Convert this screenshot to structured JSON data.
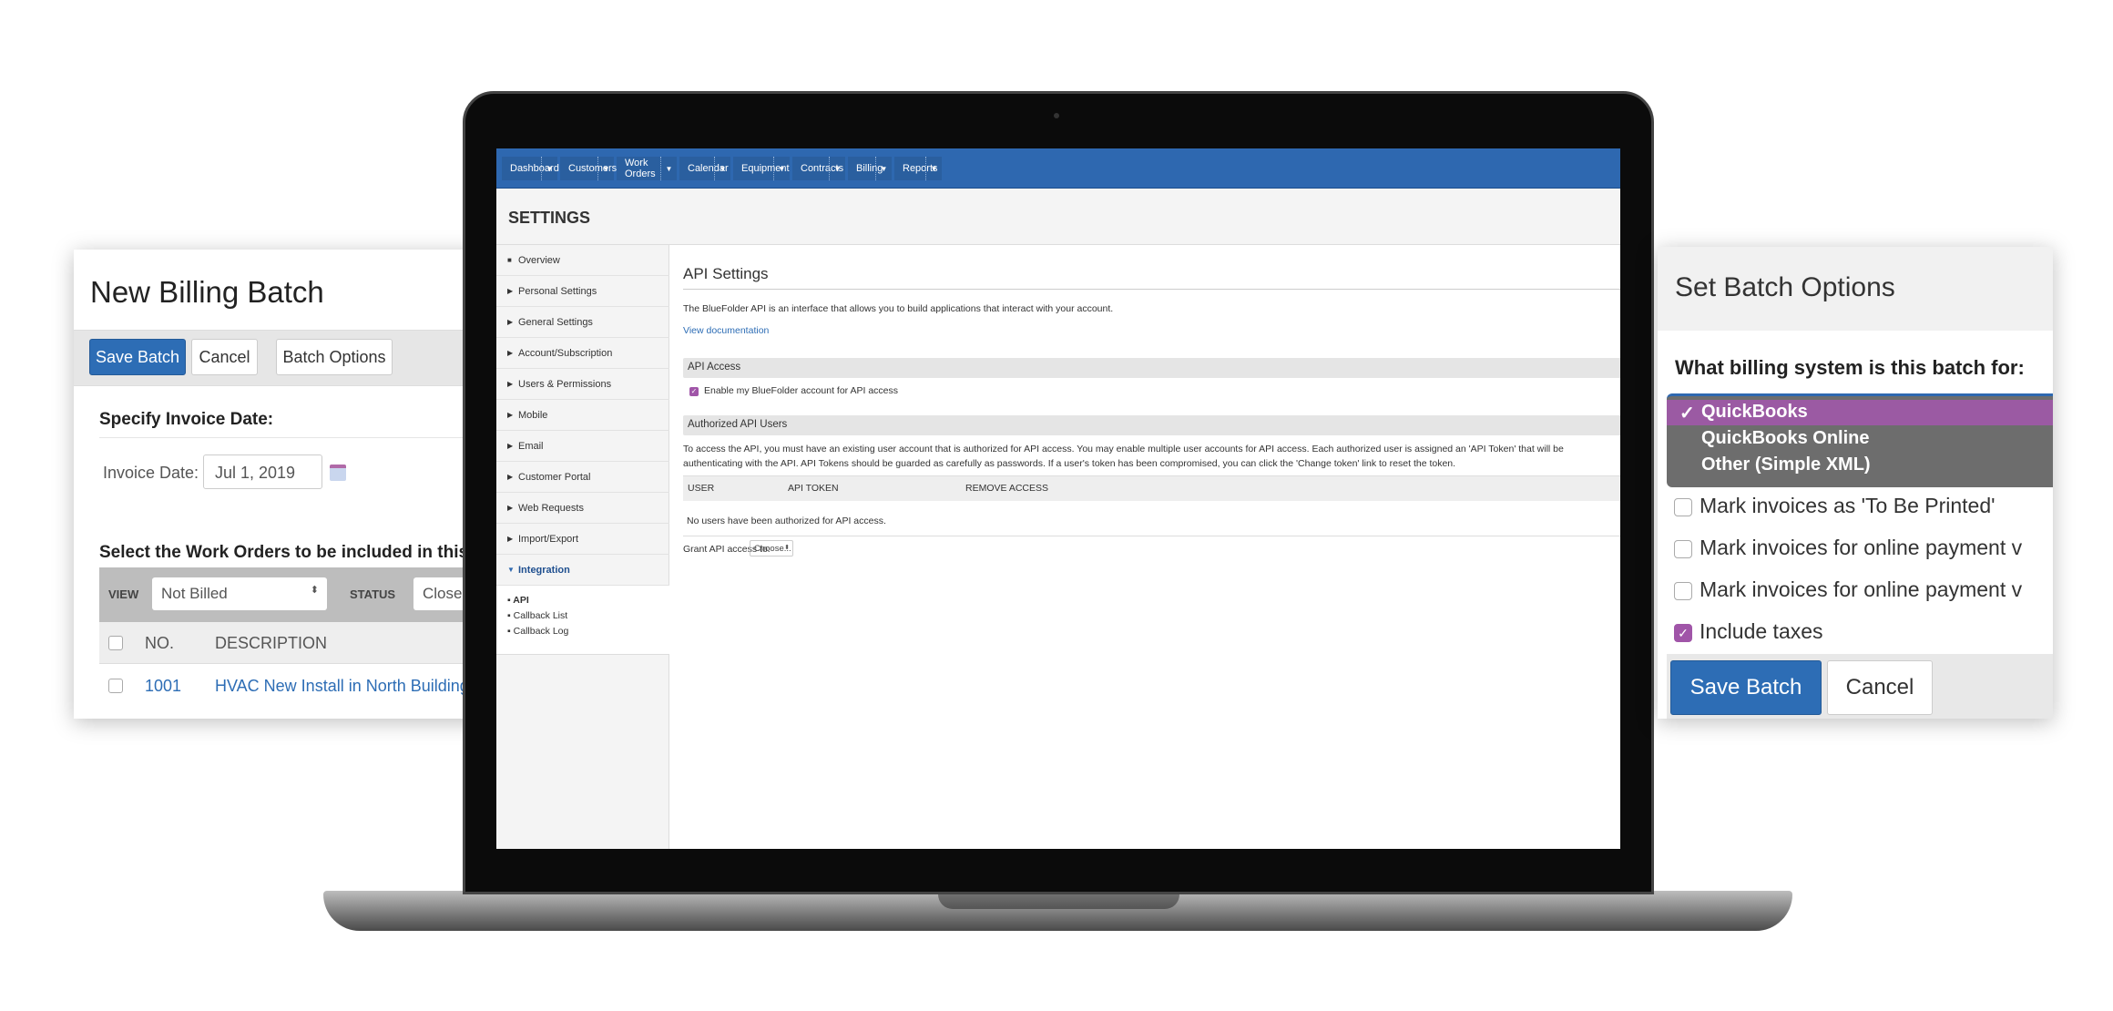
{
  "billing_batch": {
    "title": "New Billing Batch",
    "buttons": {
      "save": "Save Batch",
      "cancel": "Cancel",
      "options": "Batch Options"
    },
    "invoice_section": "Specify Invoice Date:",
    "invoice_label": "Invoice Date:",
    "invoice_value": "Jul 1, 2019",
    "work_orders_heading": "Select the Work Orders to be included in this",
    "filter": {
      "view_label": "VIEW",
      "view_value": "Not Billed",
      "status_label": "STATUS",
      "status_value": "Closed"
    },
    "columns": [
      "NO.",
      "DESCRIPTION"
    ],
    "rows": [
      {
        "no": "1001",
        "description": "HVAC New Install in North Building"
      }
    ]
  },
  "app": {
    "nav": [
      "Dashboard",
      "Customers",
      "Work Orders",
      "Calendar",
      "Equipment",
      "Contracts",
      "Billing",
      "Reports"
    ],
    "page_title": "SETTINGS",
    "sidebar": [
      "Overview",
      "Personal Settings",
      "General Settings",
      "Account/Subscription",
      "Users & Permissions",
      "Mobile",
      "Email",
      "Customer Portal",
      "Web Requests",
      "Import/Export",
      "Integration"
    ],
    "sidebar_active": "Integration",
    "sub_items": [
      "API",
      "Callback List",
      "Callback Log"
    ],
    "main": {
      "title": "API Settings",
      "intro": "The BlueFolder API is an interface that allows you to build applications that interact with your account.",
      "doc_link": "View documentation",
      "access_section": "API Access",
      "enable_label": "Enable my BlueFolder account for API access",
      "enable_checked": true,
      "users_section": "Authorized API Users",
      "users_text_1": "To access the API, you must have an existing user account that is authorized for API access. You may enable multiple user accounts for API access. Each authorized user is assigned an 'API Token' that will be",
      "users_text_2": "authenticating with the API. API Tokens should be guarded as carefully as passwords. If a user's token has been compromised, you can click the 'Change token' link to reset the token.",
      "columns": [
        "USER",
        "API TOKEN",
        "REMOVE ACCESS"
      ],
      "empty": "No users have been authorized for API access.",
      "grant_label": "Grant API access to:",
      "grant_value": "Choose..."
    }
  },
  "batch_options": {
    "title": "Set Batch Options",
    "question": "What billing system is this batch for:",
    "systems": [
      "QuickBooks",
      "QuickBooks Online",
      "Other (Simple XML)"
    ],
    "selected": "QuickBooks",
    "options": [
      {
        "label": "Mark invoices as 'To Be Printed'",
        "checked": false
      },
      {
        "label": "Mark invoices for online payment v",
        "checked": false
      },
      {
        "label": "Mark invoices for online payment v",
        "checked": false
      },
      {
        "label": "Include taxes",
        "checked": true
      }
    ],
    "buttons": {
      "save": "Save Batch",
      "cancel": "Cancel"
    }
  },
  "colors": {
    "brand_blue": "#2e68b0",
    "accent_purple": "#9b5aa3",
    "link": "#2d6db5"
  }
}
